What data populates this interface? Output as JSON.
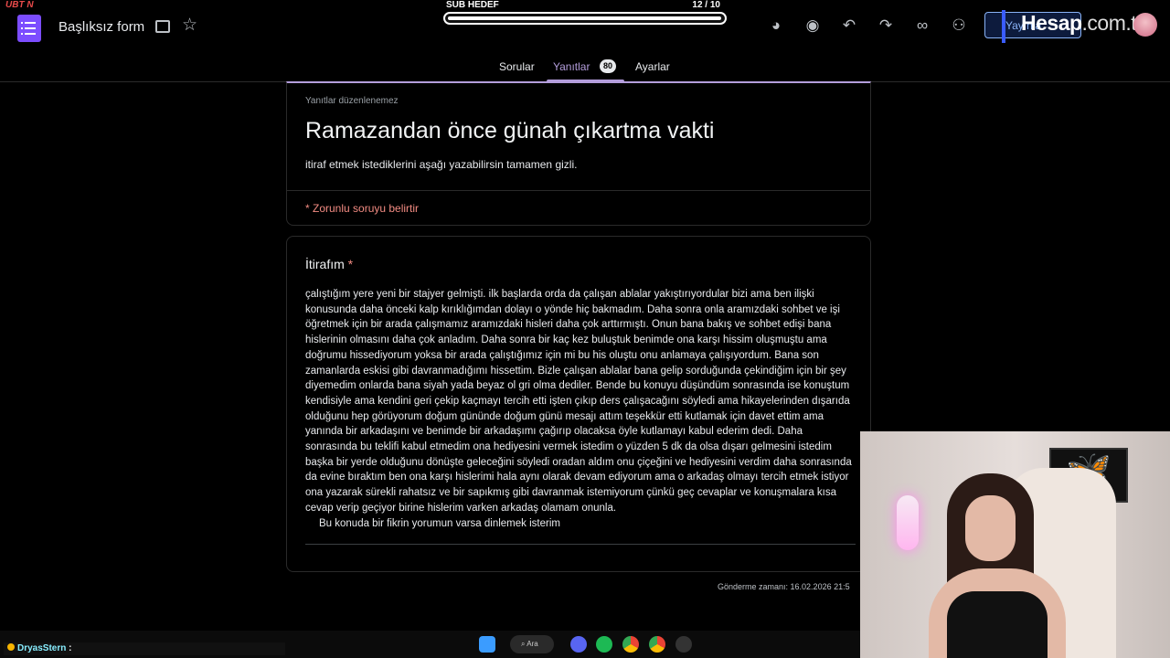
{
  "header": {
    "channel_badge": "UBT N",
    "form_title": "Başlıksız form",
    "sub_goal": {
      "label": "SUB HEDEF",
      "count": "12  / 10",
      "progress": 0.99
    },
    "publish_label": "Yayınla",
    "overlay_logo": {
      "brand": "Hesap",
      "suffix": ".com.tr"
    },
    "icons": [
      "palette-icon",
      "eye-icon",
      "undo-icon",
      "redo-icon",
      "link-icon",
      "add-person-icon"
    ]
  },
  "tabs": [
    {
      "label": "Sorular"
    },
    {
      "label": "Yanıtlar",
      "badge": "80"
    },
    {
      "label": "Ayarlar"
    }
  ],
  "form": {
    "note": "Yanıtlar düzenlenemez",
    "title": "Ramazandan önce günah çıkartma vakti",
    "description": "itiraf etmek istediklerini aşağı yazabilirsin tamamen gizli.",
    "required_note": "* Zorunlu soruyu belirtir"
  },
  "question": {
    "title": "İtirafım",
    "required_mark": "*",
    "answer": "çalıştığım yere yeni bir stajyer gelmişti. ilk başlarda orda da çalışan ablalar yakıştırıyordular bizi ama ben ilişki konusunda daha önceki kalp kırıklığımdan dolayı o yönde hiç bakmadım. Daha sonra onla aramızdaki sohbet ve işi öğretmek için bir arada çalışmamız aramızdaki hisleri daha çok arttırmıştı. Onun bana bakış ve sohbet edişi bana hislerinin olmasını daha çok anladım. Daha sonra bir kaç kez buluştuk benimde ona karşı hissim oluşmuştu ama doğrumu hissediyorum yoksa bir arada çalıştığımız için mi bu his oluştu onu anlamaya çalışıyordum. Bana son zamanlarda eskisi gibi davranmadığımı hissettim. Bizle çalışan ablalar bana gelip sorduğunda çekindiğim için bir şey diyemedim onlarda bana siyah yada beyaz ol gri olma dediler. Bende bu konuyu düşündüm sonrasında ise konuştum kendisiyle ama kendini geri çekip kaçmayı tercih etti işten çıkıp ders çalışacağını söyledi ama hikayelerinden dışarıda olduğunu hep görüyorum doğum gününde doğum günü mesajı attım teşekkür etti kutlamak için davet ettim ama yanında bir arkadaşını ve benimde bir arkadaşımı çağırıp olacaksa öyle kutlamayı kabul ederim dedi. Daha sonrasında bu teklifi kabul etmedim ona hediyesini vermek istedim o yüzden 5 dk da olsa dışarı gelmesini istedim başka bir yerde olduğunu dönüşte geleceğini söyledi oradan aldım onu çiçeğini ve hediyesini verdim daha sonrasında da evine bıraktım ben ona karşı hislerimi hala aynı olarak devam ediyorum ama o arkadaş olmayı tercih etmek istiyor ona yazarak sürekli rahatsız ve bir sapıkmış gibi davranmak istemiyorum çünkü geç cevaplar ve konuşmalara kısa cevap verip geçiyor birine hislerim varken arkadaş olamam onunla.",
    "answer_last": "Bu konuda bir fikrin yorumun varsa dinlemek isterim"
  },
  "submit_time": "Gönderme zamanı: 16.02.2026 21:5",
  "chat": {
    "user": "DryasStern",
    "separator": ":"
  },
  "taskbar": {
    "search_label": "Ara"
  }
}
